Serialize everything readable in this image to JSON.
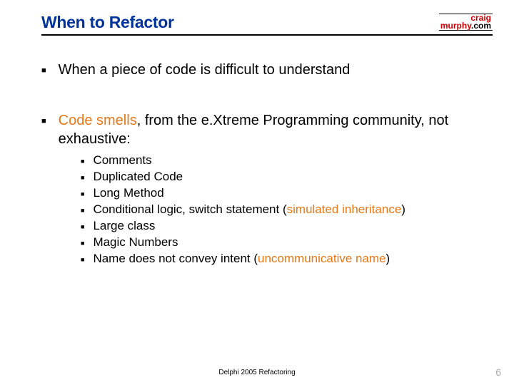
{
  "header": {
    "title": "When to Refactor",
    "logo": {
      "line1": "craig",
      "line2_a": "murphy",
      "line2_b": ".com"
    }
  },
  "bullets": {
    "b1": "When a piece of code is difficult to understand",
    "b2_pre": "Code smells",
    "b2_post": ", from the e.Xtreme Programming community, not exhaustive:",
    "sub": {
      "s1": "Comments",
      "s2": "Duplicated Code",
      "s3": "Long Method",
      "s4_pre": "Conditional logic, switch statement (",
      "s4_orange": "simulated inheritance",
      "s4_post": ")",
      "s5": "Large class",
      "s6": "Magic Numbers",
      "s7_pre": "Name does not convey intent (",
      "s7_orange": "uncommunicative name",
      "s7_post": ")"
    }
  },
  "footer": {
    "text": "Delphi 2005 Refactoring",
    "page": "6"
  }
}
